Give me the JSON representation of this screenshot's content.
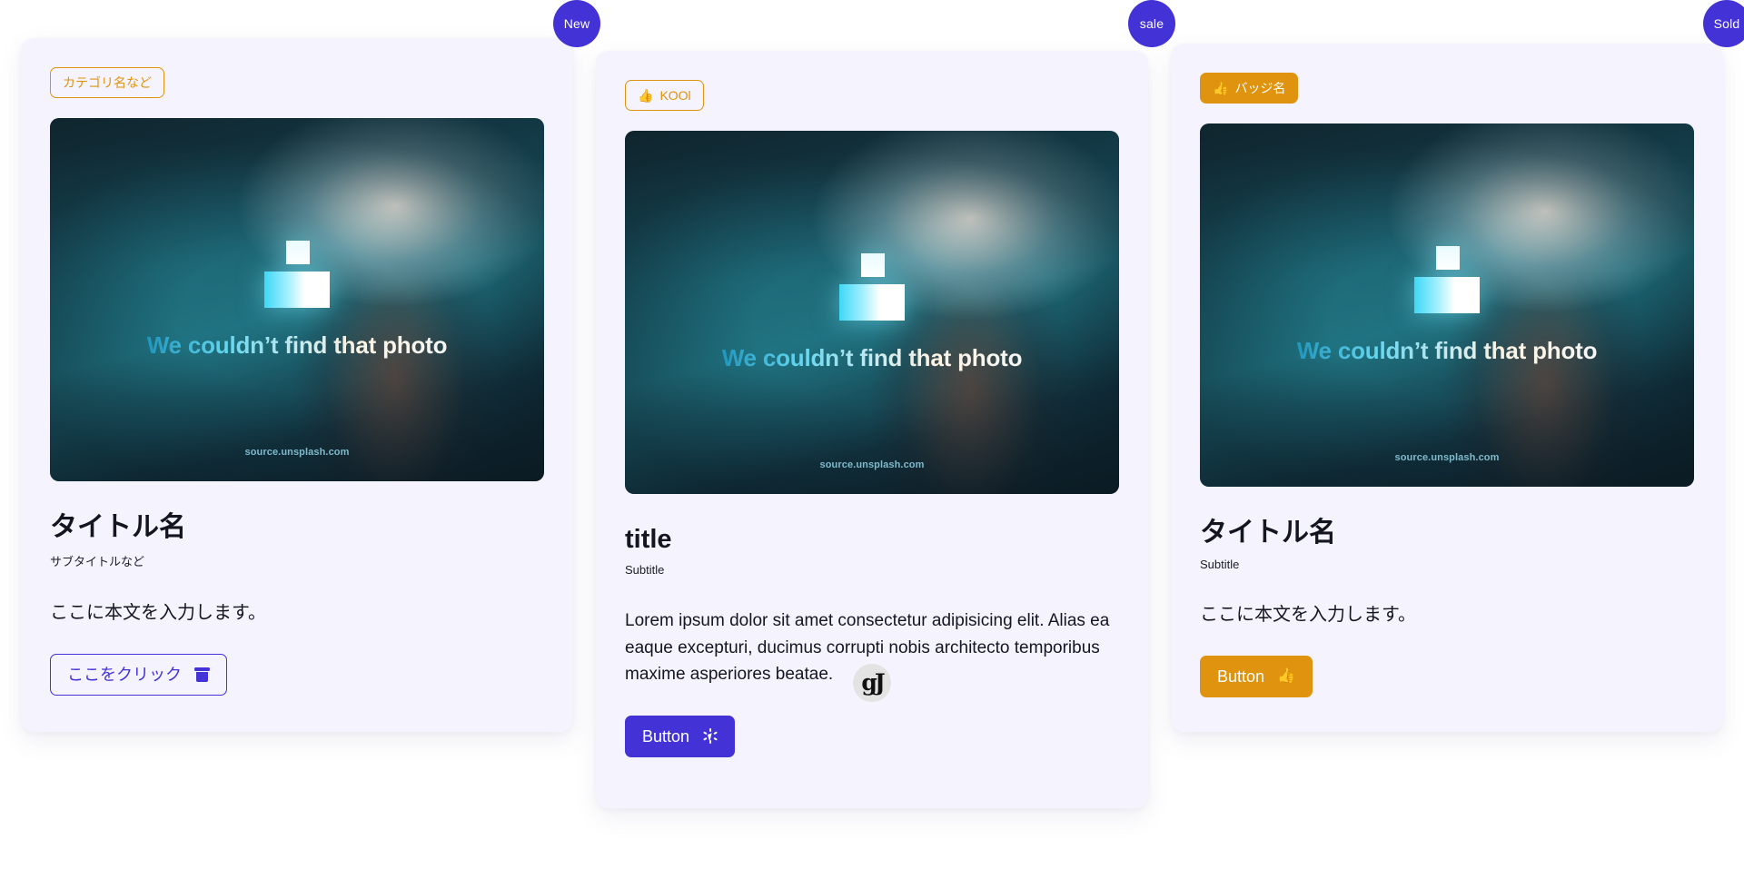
{
  "theme": {
    "page_background": "#ffffff",
    "card_background": "#f5f3fe",
    "accent_indigo": "#4333d6",
    "accent_orange": "#e0930e",
    "text_dark": "#14161f"
  },
  "placeholder_image": {
    "message": "We couldn’t find that photo",
    "source": "source.unsplash.com",
    "logo_icon": "unsplash-logo-icon"
  },
  "cards": [
    {
      "corner_badge": {
        "label": "New",
        "color": "#4333d6"
      },
      "tag": {
        "label": "カテゴリ名など",
        "style": "outline",
        "icon": "",
        "color": "#e0930e"
      },
      "title": "タイトル名",
      "subtitle": "サブタイトルなど",
      "body": "ここに本文を入力します。",
      "button": {
        "label": "ここをクリック",
        "style": "outline-indigo",
        "icon": "trash-icon",
        "color": "#4333d6"
      }
    },
    {
      "corner_badge": {
        "label": "sale",
        "color": "#4333d6"
      },
      "tag": {
        "label": "KOOl",
        "style": "outline",
        "icon": "thumbs-up-icon",
        "icon_glyph": "👍",
        "color": "#e0930e"
      },
      "title": "title",
      "subtitle": "Subtitle",
      "body": "Lorem ipsum dolor sit amet consectetur adipisicing elit. Alias ea eaque excepturi, ducimus corrupti nobis architecto temporibus maxime asperiores beatae.",
      "button": {
        "label": "Button",
        "style": "solid-indigo",
        "icon": "click-cursor-icon",
        "color": "#4333d6"
      }
    },
    {
      "corner_badge": {
        "label": "Sold",
        "color": "#4333d6"
      },
      "tag": {
        "label": "バッジ名",
        "style": "filled",
        "icon": "thumbs-up-icon",
        "icon_glyph": "👍",
        "color": "#e0930e"
      },
      "title": "タイトル名",
      "subtitle": "Subtitle",
      "body": "ここに本文を入力します。",
      "button": {
        "label": "Button",
        "style": "solid-orange",
        "icon": "thumbs-up-icon",
        "icon_glyph": "👍",
        "color": "#e0930e"
      }
    }
  ],
  "footer": {
    "avatar_glyph": "gJ",
    "avatar_icon": "site-logo-icon"
  }
}
